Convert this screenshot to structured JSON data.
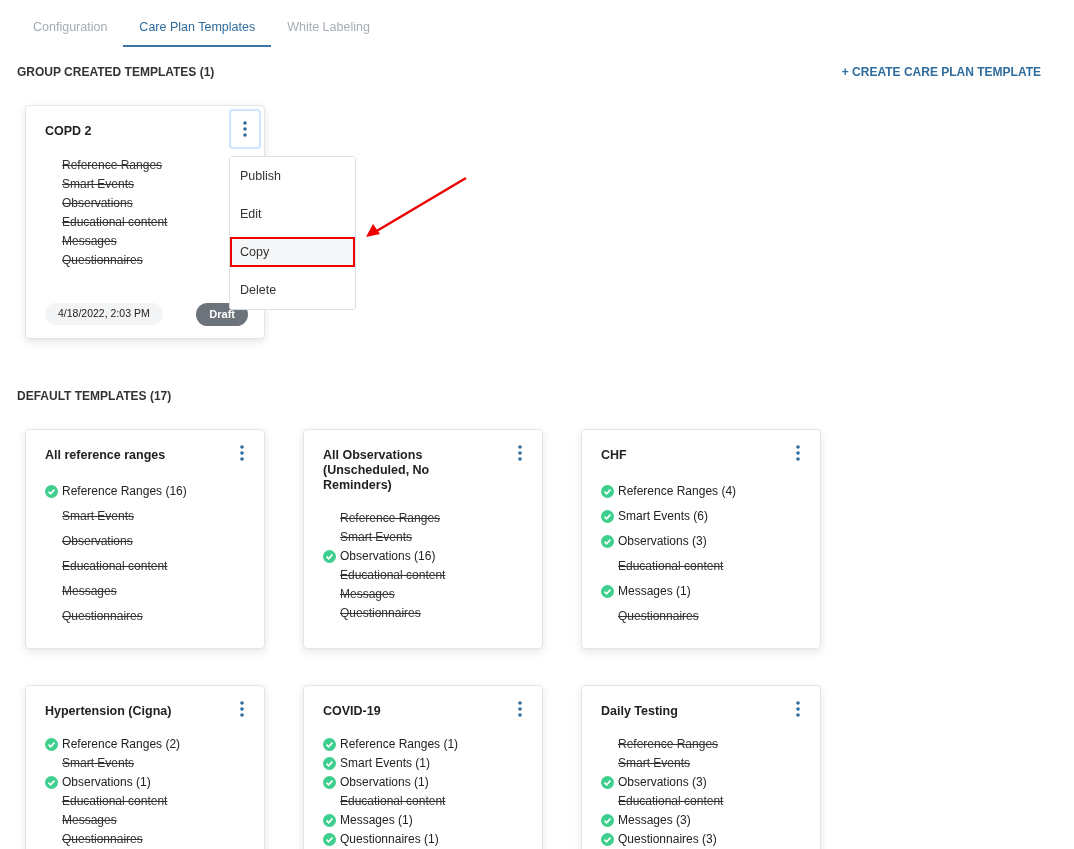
{
  "tabs": [
    {
      "label": "Configuration",
      "selected": false
    },
    {
      "label": "Care Plan Templates",
      "selected": true
    },
    {
      "label": "White Labeling",
      "selected": false
    }
  ],
  "group_section": {
    "title": "GROUP CREATED TEMPLATES (1)",
    "action": "+ CREATE CARE PLAN TEMPLATE",
    "cards": [
      {
        "title": "COPD 2",
        "menu_open": true,
        "items": [
          {
            "label": "Reference Ranges",
            "included": false
          },
          {
            "label": "Smart Events",
            "included": false
          },
          {
            "label": "Observations",
            "included": false
          },
          {
            "label": "Educational content",
            "included": false
          },
          {
            "label": "Messages",
            "included": false
          },
          {
            "label": "Questionnaires",
            "included": false
          }
        ],
        "date": "4/18/2022, 2:03 PM",
        "status": "Draft"
      }
    ]
  },
  "menu": {
    "items": [
      {
        "label": "Publish",
        "highlighted": false
      },
      {
        "label": "Edit",
        "highlighted": false
      },
      {
        "label": "Copy",
        "highlighted": true
      },
      {
        "label": "Delete",
        "highlighted": false
      }
    ]
  },
  "default_section": {
    "title": "DEFAULT TEMPLATES (17)",
    "cards": [
      {
        "title": "All reference ranges",
        "items": [
          {
            "label": "Reference Ranges (16)",
            "included": true
          },
          {
            "label": "Smart Events",
            "included": false
          },
          {
            "label": "Observations",
            "included": false
          },
          {
            "label": "Educational content",
            "included": false
          },
          {
            "label": "Messages",
            "included": false
          },
          {
            "label": "Questionnaires",
            "included": false
          }
        ]
      },
      {
        "title": "All Observations (Unscheduled, No Reminders)",
        "items": [
          {
            "label": "Reference Ranges",
            "included": false
          },
          {
            "label": "Smart Events",
            "included": false
          },
          {
            "label": "Observations (16)",
            "included": true
          },
          {
            "label": "Educational content",
            "included": false
          },
          {
            "label": "Messages",
            "included": false
          },
          {
            "label": "Questionnaires",
            "included": false
          }
        ]
      },
      {
        "title": "CHF",
        "items": [
          {
            "label": "Reference Ranges (4)",
            "included": true
          },
          {
            "label": "Smart Events (6)",
            "included": true
          },
          {
            "label": "Observations (3)",
            "included": true
          },
          {
            "label": "Educational content",
            "included": false
          },
          {
            "label": "Messages (1)",
            "included": true
          },
          {
            "label": "Questionnaires",
            "included": false
          }
        ]
      },
      {
        "title": "Hypertension (Cigna)",
        "items": [
          {
            "label": "Reference Ranges (2)",
            "included": true
          },
          {
            "label": "Smart Events",
            "included": false
          },
          {
            "label": "Observations (1)",
            "included": true
          },
          {
            "label": "Educational content",
            "included": false
          },
          {
            "label": "Messages",
            "included": false
          },
          {
            "label": "Questionnaires",
            "included": false
          }
        ]
      },
      {
        "title": "COVID-19",
        "items": [
          {
            "label": "Reference Ranges (1)",
            "included": true
          },
          {
            "label": "Smart Events (1)",
            "included": true
          },
          {
            "label": "Observations (1)",
            "included": true
          },
          {
            "label": "Educational content",
            "included": false
          },
          {
            "label": "Messages (1)",
            "included": true
          },
          {
            "label": "Questionnaires (1)",
            "included": true
          }
        ]
      },
      {
        "title": "Daily Testing",
        "items": [
          {
            "label": "Reference Ranges",
            "included": false
          },
          {
            "label": "Smart Events",
            "included": false
          },
          {
            "label": "Observations (3)",
            "included": true
          },
          {
            "label": "Educational content",
            "included": false
          },
          {
            "label": "Messages (3)",
            "included": true
          },
          {
            "label": "Questionnaires (3)",
            "included": true
          }
        ]
      }
    ]
  }
}
